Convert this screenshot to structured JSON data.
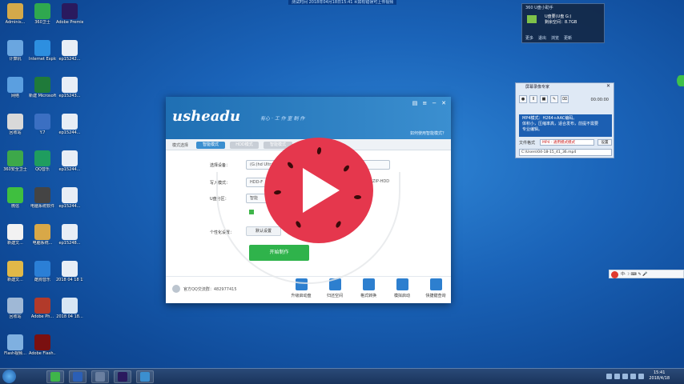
{
  "topbar": {
    "text": "测试时间 2018年04月18日15:41  ※如有错误可上传视频"
  },
  "desktop_icons": [
    {
      "label": "Adminis...",
      "color": "#d4a94a"
    },
    {
      "label": "360卫士",
      "color": "#2fa84f"
    },
    {
      "label": "Adobe Premie...",
      "color": "#2a1a5e"
    },
    {
      "label": "计算机",
      "color": "#6aa6e0"
    },
    {
      "label": "Internet Explorer",
      "color": "#2d8fe0"
    },
    {
      "label": "ep15242...",
      "color": "#e8eef6"
    },
    {
      "label": "网络",
      "color": "#5b9fe0"
    },
    {
      "label": "新建 Microsoft...",
      "color": "#1f7a3a"
    },
    {
      "label": "ep15243...",
      "color": "#e8eef6"
    },
    {
      "label": "回收站",
      "color": "#d9d9d9"
    },
    {
      "label": "Y.7",
      "color": "#3b6fc2"
    },
    {
      "label": "ep15244...",
      "color": "#e8eef6"
    },
    {
      "label": "360安全卫士",
      "color": "#3da84a"
    },
    {
      "label": "QQ音乐",
      "color": "#1f9d5f"
    },
    {
      "label": "ep15244...",
      "color": "#e8eef6"
    },
    {
      "label": "微信",
      "color": "#3fbf3f"
    },
    {
      "label": "电脑系统软件",
      "color": "#444"
    },
    {
      "label": "ep15244...",
      "color": "#e8eef6"
    },
    {
      "label": "新建文...",
      "color": "#f2f2f2"
    },
    {
      "label": "电脑系统...",
      "color": "#d8a848"
    },
    {
      "label": "ep15248...",
      "color": "#e8eef6"
    },
    {
      "label": "新建文...",
      "color": "#e0b848"
    },
    {
      "label": "酷狗音乐",
      "color": "#2b7fd6"
    },
    {
      "label": "2018 04 18 15...",
      "color": "#e8eef6"
    },
    {
      "label": "回收站",
      "color": "#9fb8d6"
    },
    {
      "label": "Adobe Ph...",
      "color": "#b23a2a"
    },
    {
      "label": "2018 04 18...",
      "color": "#d8e6f4"
    },
    {
      "label": "Flash视频...",
      "color": "#7fb0e0"
    },
    {
      "label": "Adobe Flash...",
      "color": "#7a1010"
    }
  ],
  "main_window": {
    "logo": "usheadu",
    "slogan": "有心 · 工 作 室 制 作",
    "help_link": "如何使用智能模式？",
    "mode_label": "模式选择",
    "tabs": [
      "智能模式",
      "HDD模式",
      "智能模式"
    ],
    "fields": {
      "device_label": "选择设备：",
      "device_value": "(G:)hd Ultra...",
      "write_label": "写入模式：",
      "write_value": "HDD-F",
      "write_extra": "ZIP-HDD",
      "partition_label": "U盘分区：",
      "partition_value": "智能",
      "personal_label": "个性化设置：",
      "personal_value": "默认设置"
    },
    "start_button": "开始制作",
    "qq_group": "官方QQ交流群：482977415",
    "tools": [
      "升级启动盘",
      "归还空间",
      "格式转换",
      "模拟启动",
      "快捷键查询"
    ]
  },
  "tray_window": {
    "title": "360 U盘小助手",
    "name": "U盘要(U盘 G:)",
    "space": "剩余空间：8.7GB",
    "actions": [
      "更多",
      "退出",
      "浏览",
      "更新"
    ]
  },
  "recorder": {
    "title": "屏幕录像专家",
    "close": "✕",
    "controls": [
      "●",
      "Ⅱ",
      "■",
      "✎",
      "⌧"
    ],
    "time": "00:00:00",
    "screen_lines": [
      "MP4模式：H264+AAC编码。",
      "体积小，压缩率高，适合发布，前提不需要",
      "专业编辑。"
    ],
    "format_label": "文件格式",
    "format_value": "MP4 - 通用模式模式",
    "settings_button": "设置",
    "path": "C:\\Users\\04-18-15_41_36.mp4"
  },
  "ime_bar": {
    "text": "中·☽ ⌨ ✎ 🎤"
  },
  "taskbar": {
    "items": [
      {
        "name": "start",
        "color": "#3b8fd0"
      },
      {
        "name": "360",
        "color": "#3fb54a"
      },
      {
        "name": "word",
        "color": "#2b5fb6"
      },
      {
        "name": "window",
        "color": "#6a7fa0"
      },
      {
        "name": "premiere",
        "color": "#2a1a5e"
      },
      {
        "name": "usheadu",
        "color": "#3b8fd0"
      }
    ],
    "clock_time": "15:41",
    "clock_date": "2018/4/18"
  },
  "colors": {
    "accent": "#3b8fd0",
    "start_green": "#2fb34b",
    "overlay_red": "#e5374d"
  }
}
